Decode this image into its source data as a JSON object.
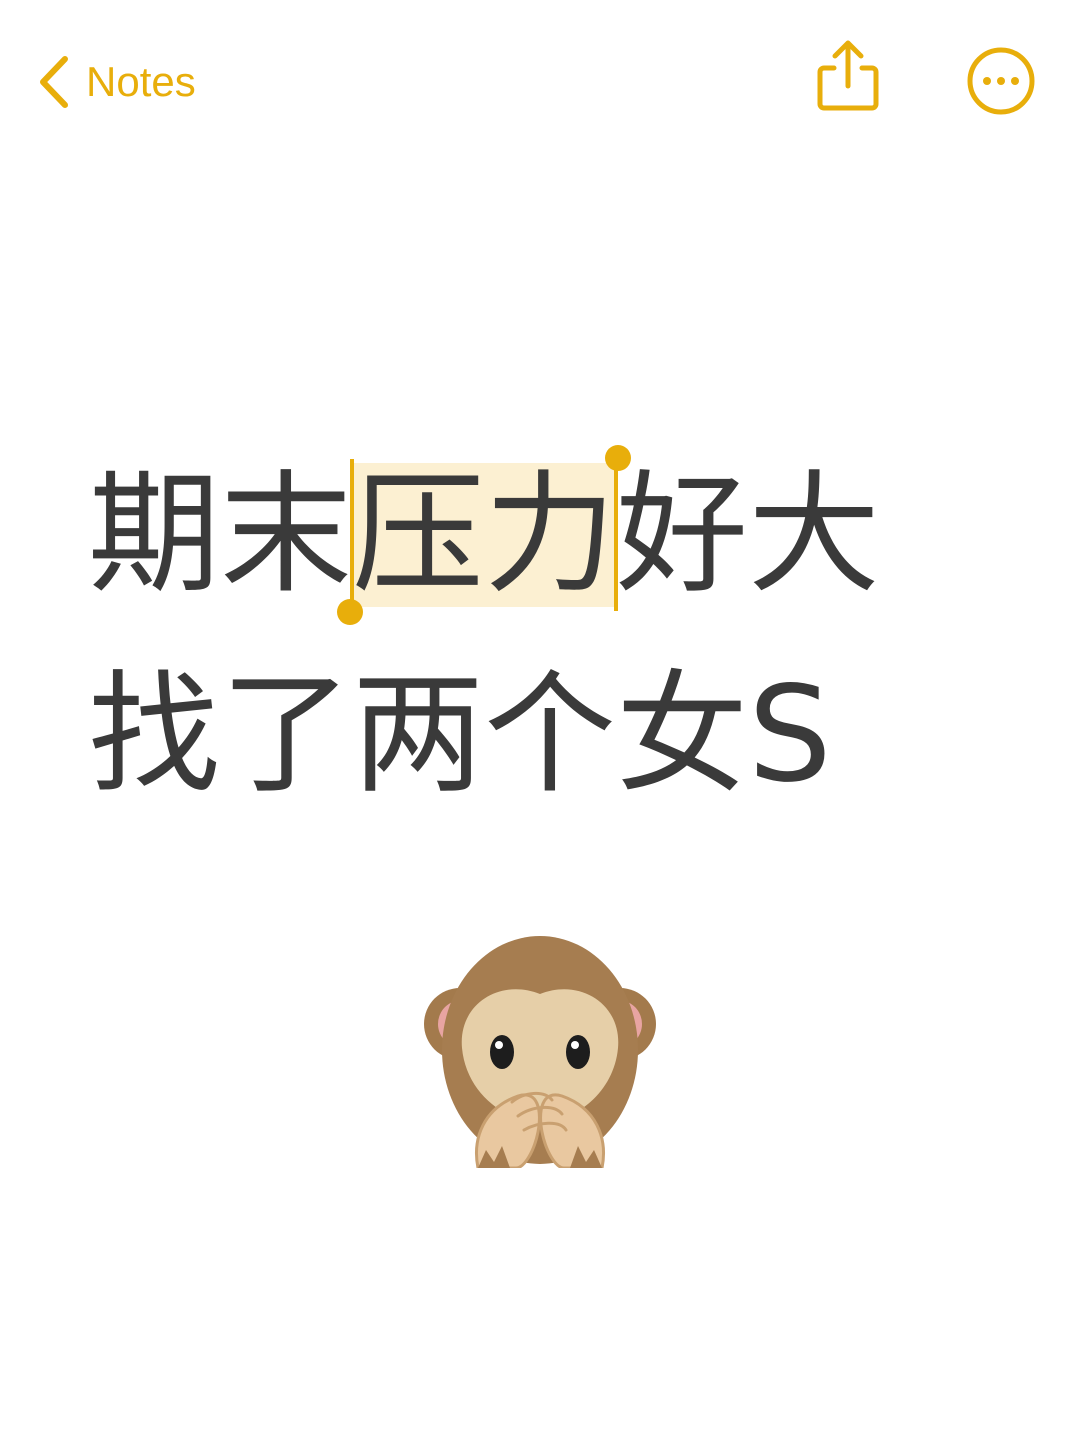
{
  "nav": {
    "back_label": "Notes",
    "back_icon": "chevron-left-icon",
    "share_icon": "share-icon",
    "more_icon": "ellipsis-circle-icon"
  },
  "note": {
    "line1_before": "期末",
    "line1_selected": "压力",
    "line1_after": "好大",
    "line2": "找了两个女S"
  },
  "emoji": "see-no-evil-monkey",
  "colors": {
    "accent": "#E8AE0B",
    "selection": "#FCF0D2",
    "text": "#3a3a3a",
    "background": "#ffffff"
  }
}
